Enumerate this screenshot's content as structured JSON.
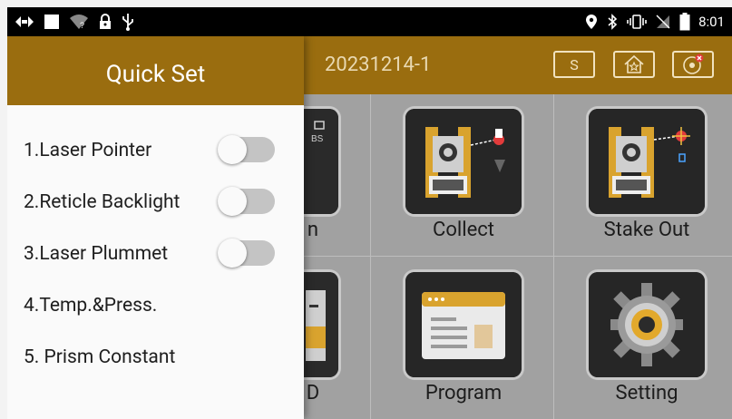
{
  "status_bar": {
    "time": "8:01",
    "left_icons": [
      "diamond-arrows-icon",
      "square-icon",
      "wifi-question-icon",
      "lock-icon",
      "usb-icon"
    ],
    "right_icons": [
      "location-icon",
      "bluetooth-icon",
      "vibrate-icon",
      "no-sim-icon",
      "battery-icon"
    ]
  },
  "app_bar": {
    "project_name": "20231214-1",
    "buttons": [
      {
        "label": "S"
      },
      {
        "icon": "home-star-icon"
      },
      {
        "icon": "target-cancel-icon"
      }
    ]
  },
  "main_menu": {
    "items": [
      {
        "label": "n",
        "icon": "station-setup-icon"
      },
      {
        "label": "Collect",
        "icon": "collect-icon"
      },
      {
        "label": "Stake Out",
        "icon": "stake-out-icon"
      },
      {
        "label": "D",
        "icon": "data-icon"
      },
      {
        "label": "Program",
        "icon": "program-icon"
      },
      {
        "label": "Setting",
        "icon": "setting-gear-icon"
      }
    ]
  },
  "drawer": {
    "title": "Quick Set",
    "items": [
      {
        "label": "1.Laser Pointer",
        "toggle": false
      },
      {
        "label": "2.Reticle Backlight",
        "toggle": false
      },
      {
        "label": "3.Laser Plummet",
        "toggle": false
      },
      {
        "label": "4.Temp.&Press."
      },
      {
        "label": "5. Prism Constant"
      }
    ]
  },
  "colors": {
    "accent": "#9a6d0f",
    "drawer_bg": "#fafafa",
    "grid_bg": "#a1a1a1"
  }
}
